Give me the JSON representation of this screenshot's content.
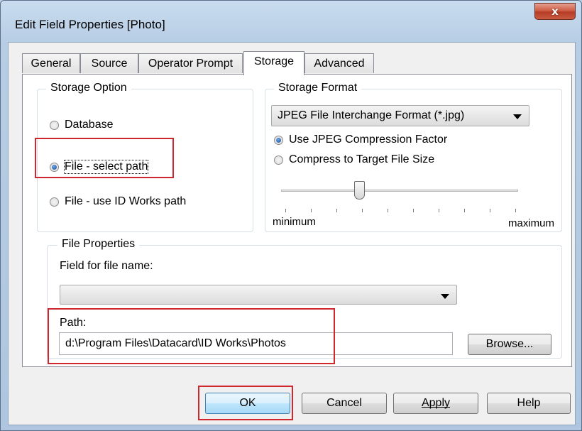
{
  "window": {
    "title": "Edit Field Properties [Photo]",
    "close_symbol": "x"
  },
  "tabs": [
    {
      "label": "General",
      "active": false
    },
    {
      "label": "Source",
      "active": false
    },
    {
      "label": "Operator Prompt",
      "active": false
    },
    {
      "label": "Storage",
      "active": true
    },
    {
      "label": "Advanced",
      "active": false
    }
  ],
  "storage_option": {
    "title": "Storage Option",
    "options": [
      {
        "label": "Database",
        "checked": false
      },
      {
        "label": "File - select path",
        "checked": true
      },
      {
        "label": "File - use ID Works path",
        "checked": false
      }
    ]
  },
  "storage_format": {
    "title": "Storage Format",
    "format_value": "JPEG File Interchange Format (*.jpg)",
    "options": [
      {
        "label": "Use JPEG Compression Factor",
        "checked": true
      },
      {
        "label": "Compress to Target File Size",
        "checked": false
      }
    ],
    "slider": {
      "min_label": "minimum",
      "max_label": "maximum",
      "position_fraction": 0.33
    }
  },
  "file_properties": {
    "title": "File Properties",
    "field_label": "Field for file name:",
    "field_value": "",
    "path_label": "Path:",
    "path_value": "d:\\Program Files\\Datacard\\ID Works\\Photos",
    "browse_label": "Browse..."
  },
  "buttons": {
    "ok": "OK",
    "cancel": "Cancel",
    "apply": "Apply",
    "help": "Help"
  },
  "colors": {
    "highlight": "#d0262d",
    "close_button": "#c9513a",
    "title_bar": "#bcd3ea"
  }
}
